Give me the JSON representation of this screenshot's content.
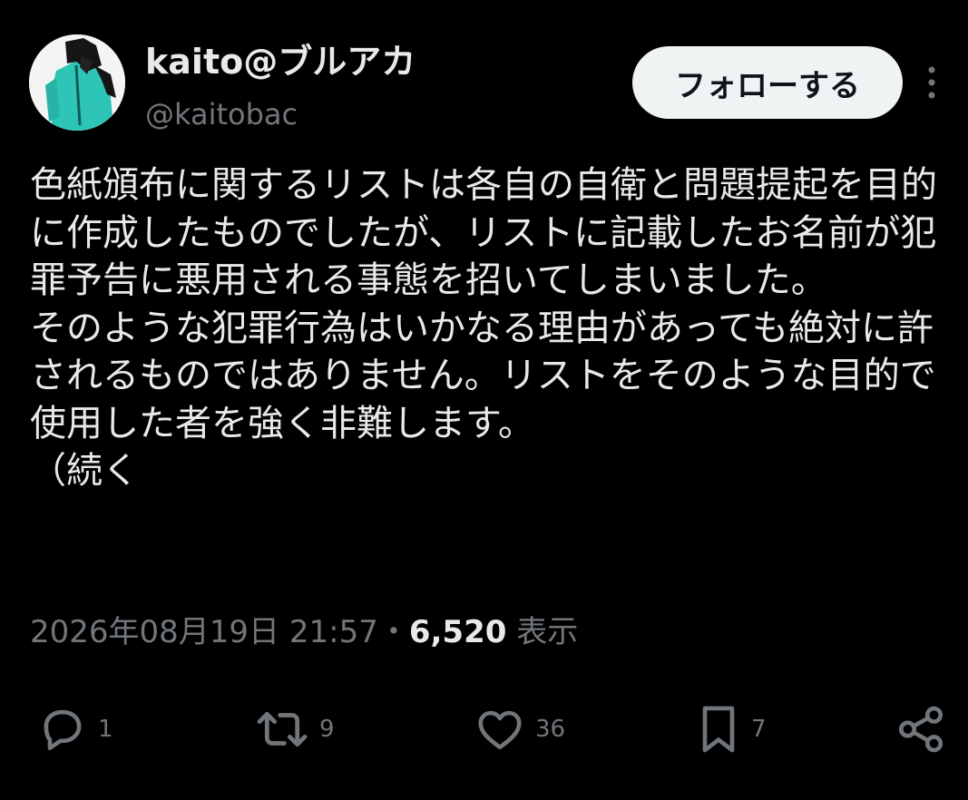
{
  "author": {
    "display_name": "kaito@ブルアカ",
    "handle": "@kaitobac",
    "avatar_icon": "avatar-image"
  },
  "follow_button": {
    "label": "フォローする"
  },
  "more_icon": "more-vertical-icon",
  "tweet": {
    "text": "色紙頒布に関するリストは各自の自衛と問題提起を目的に作成したものでしたが、リストに記載したお名前が犯罪予告に悪用される事態を招いてしまいました。\nそのような犯罪行為はいかなる理由があっても絶対に許されるものではありません。リストをそのような目的で使用した者を強く非難します。\n（続く"
  },
  "meta": {
    "timestamp": "2026年08月19日 21:57",
    "separator": "・",
    "views_count": "6,520",
    "views_label": "表示"
  },
  "actions": {
    "reply": {
      "icon": "reply-icon",
      "count": "1"
    },
    "repost": {
      "icon": "repost-icon",
      "count": "9"
    },
    "like": {
      "icon": "heart-icon",
      "count": "36"
    },
    "bookmark": {
      "icon": "bookmark-icon",
      "count": "7"
    },
    "share": {
      "icon": "share-icon"
    }
  },
  "colors": {
    "background": "#000000",
    "primary_text": "#e7e9ea",
    "secondary_text": "#71767b",
    "button_bg": "#eff3f4",
    "button_text": "#0f1419"
  }
}
